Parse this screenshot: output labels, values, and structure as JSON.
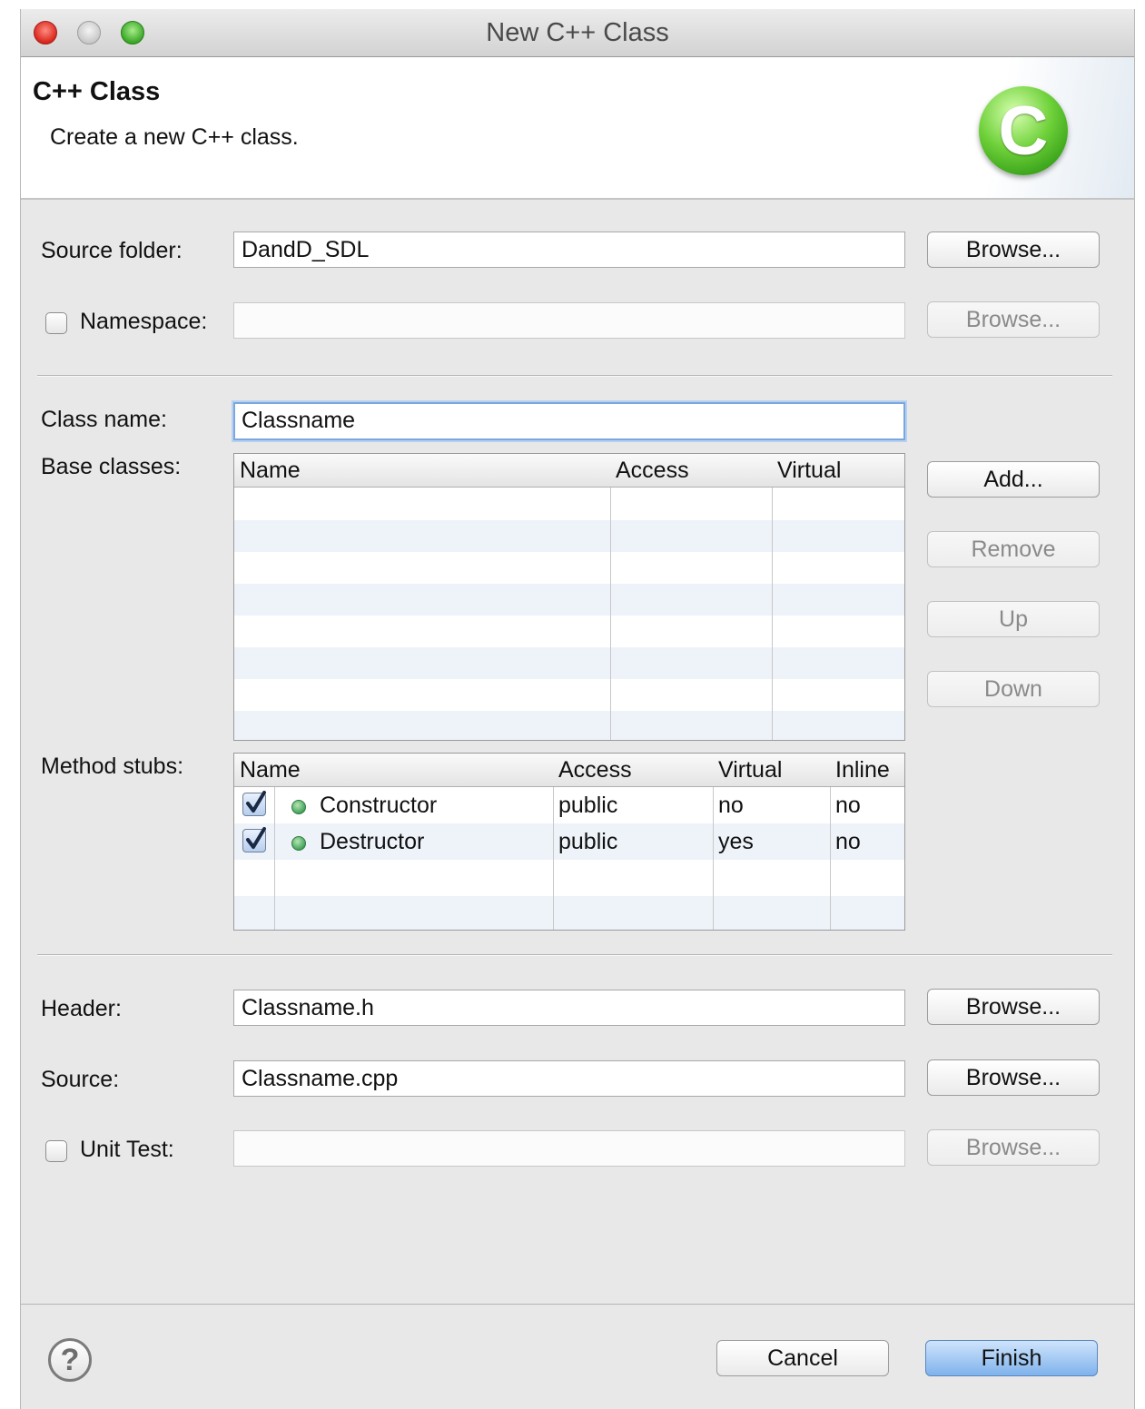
{
  "window": {
    "title": "New C++ Class"
  },
  "banner": {
    "title": "C++ Class",
    "description": "Create a new C++ class.",
    "logo_letter": "C"
  },
  "source_folder": {
    "label": "Source folder:",
    "value": "DandD_SDL",
    "browse_label": "Browse..."
  },
  "namespace": {
    "label": "Namespace:",
    "checked": false,
    "value": "",
    "browse_label": "Browse..."
  },
  "class_name": {
    "label": "Class name:",
    "value": "Classname"
  },
  "base_classes": {
    "label": "Base classes:",
    "columns": [
      "Name",
      "Access",
      "Virtual"
    ],
    "rows": [],
    "buttons": {
      "add": "Add...",
      "remove": "Remove",
      "up": "Up",
      "down": "Down"
    }
  },
  "method_stubs": {
    "label": "Method stubs:",
    "columns": [
      "Name",
      "Access",
      "Virtual",
      "Inline"
    ],
    "rows": [
      {
        "checked": true,
        "name": "Constructor",
        "access": "public",
        "virtual": "no",
        "inline": "no"
      },
      {
        "checked": true,
        "name": "Destructor",
        "access": "public",
        "virtual": "yes",
        "inline": "no"
      }
    ]
  },
  "header": {
    "label": "Header:",
    "value": "Classname.h",
    "browse_label": "Browse..."
  },
  "source": {
    "label": "Source:",
    "value": "Classname.cpp",
    "browse_label": "Browse..."
  },
  "unit_test": {
    "label": "Unit Test:",
    "checked": false,
    "value": "",
    "browse_label": "Browse..."
  },
  "footer": {
    "help_icon": "?",
    "cancel_label": "Cancel",
    "finish_label": "Finish"
  },
  "colors": {
    "accent": "#7fb2ec",
    "close": "#d9261c",
    "maximize": "#3aa827",
    "logo": "#6fd13a"
  }
}
